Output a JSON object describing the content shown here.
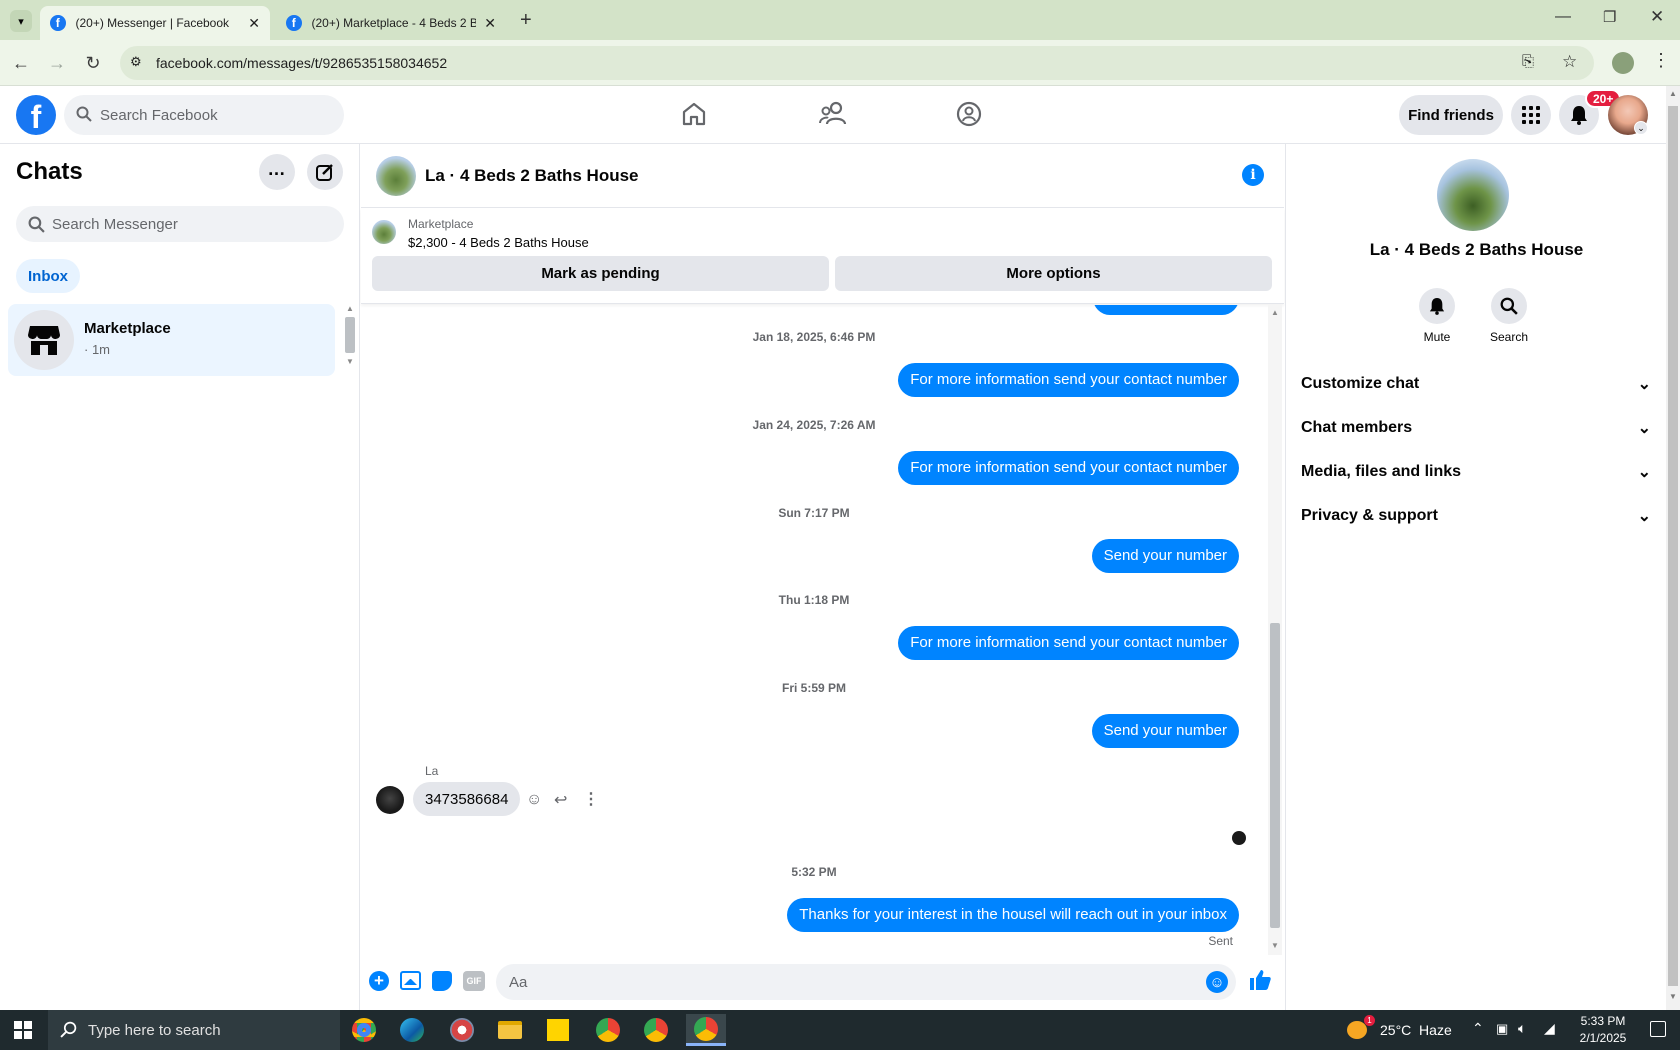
{
  "browser": {
    "tabs": [
      {
        "label": "(20+) Messenger | Facebook",
        "active": true
      },
      {
        "label": "(20+) Marketplace - 4 Beds 2 Ba",
        "active": false
      }
    ],
    "url": "facebook.com/messages/t/9286535158034652"
  },
  "fb_header": {
    "search_placeholder": "Search Facebook",
    "find_friends": "Find friends",
    "notification_badge": "20+"
  },
  "chats_panel": {
    "title": "Chats",
    "search_placeholder": "Search Messenger",
    "filter_inbox": "Inbox",
    "items": [
      {
        "name": "Marketplace",
        "meta": "· 1m"
      }
    ]
  },
  "conversation": {
    "title": "La · 4 Beds 2 Baths House",
    "listing_source": "Marketplace",
    "listing_title": "$2,300 - 4 Beds 2 Baths House",
    "mark_pending": "Mark as pending",
    "more_options": "More options",
    "messages": [
      {
        "type": "ts",
        "text": "Jan 18, 2025, 6:46 PM"
      },
      {
        "type": "out",
        "text": "For more information send your contact number"
      },
      {
        "type": "ts",
        "text": "Jan 24, 2025, 7:26 AM"
      },
      {
        "type": "out",
        "text": "For more information send your contact number"
      },
      {
        "type": "ts",
        "text": "Sun 7:17 PM"
      },
      {
        "type": "out",
        "text": "Send your number"
      },
      {
        "type": "ts",
        "text": "Thu 1:18 PM"
      },
      {
        "type": "out",
        "text": "For more information send your contact number"
      },
      {
        "type": "ts",
        "text": "Fri 5:59 PM"
      },
      {
        "type": "out",
        "text": "Send your number"
      },
      {
        "type": "in_sender",
        "text": "La"
      },
      {
        "type": "in",
        "text": "3473586684"
      },
      {
        "type": "ts",
        "text": "5:32 PM"
      },
      {
        "type": "out",
        "text": "Thanks for your interest in the housel will reach out in your inbox"
      },
      {
        "type": "status",
        "text": "Sent"
      }
    ],
    "composer_placeholder": "Aa"
  },
  "info_panel": {
    "name": "La · 4 Beds 2 Baths House",
    "mute_label": "Mute",
    "search_label": "Search",
    "sections": [
      "Customize chat",
      "Chat members",
      "Media, files and links",
      "Privacy & support"
    ]
  },
  "taskbar": {
    "search_placeholder": "Type here to search",
    "weather": "25°C  Haze",
    "time": "5:33 PM",
    "date": "2/1/2025"
  },
  "colors": {
    "fb_blue": "#1877f2",
    "bubble_blue": "#0084ff",
    "badge_red": "#e41e3f"
  }
}
